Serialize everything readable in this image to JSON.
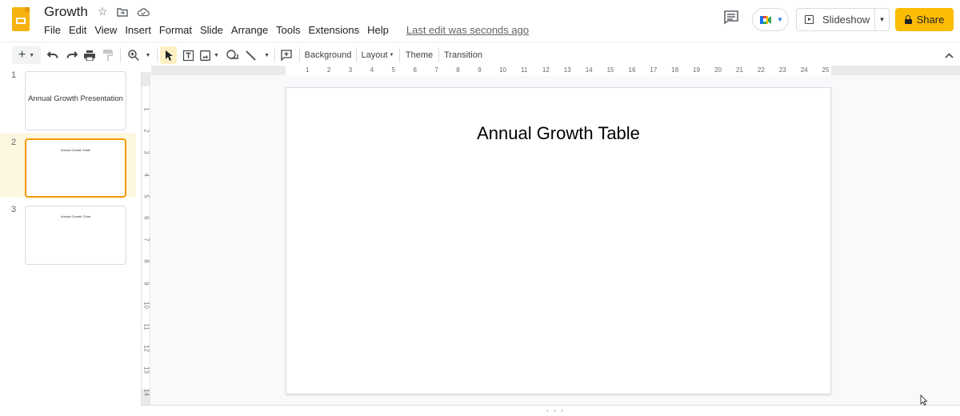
{
  "app": {
    "document_title": "Growth",
    "title_icons": [
      "star-icon",
      "move-to-folder-icon",
      "cloud-saved-icon"
    ],
    "menu": [
      "File",
      "Edit",
      "View",
      "Insert",
      "Format",
      "Slide",
      "Arrange",
      "Tools",
      "Extensions",
      "Help"
    ],
    "last_edit": "Last edit was seconds ago"
  },
  "header_actions": {
    "slideshow_label": "Slideshow",
    "share_label": "Share",
    "accent_color": "#fbbc04"
  },
  "toolbar": {
    "background_label": "Background",
    "layout_label": "Layout",
    "theme_label": "Theme",
    "transition_label": "Transition"
  },
  "filmstrip": {
    "slides": [
      {
        "number": "1",
        "title": "Annual Growth Presentation",
        "selected": false
      },
      {
        "number": "2",
        "title": "Annual Growth Table",
        "selected": true
      },
      {
        "number": "3",
        "title": "Annual Growth Chart",
        "selected": false
      }
    ]
  },
  "rulers": {
    "horizontal": [
      "1",
      "2",
      "3",
      "4",
      "5",
      "6",
      "7",
      "8",
      "9",
      "10",
      "11",
      "12",
      "13",
      "14",
      "15",
      "16",
      "17",
      "18",
      "19",
      "20",
      "21",
      "22",
      "23",
      "24",
      "25"
    ],
    "vertical": [
      "1",
      "2",
      "3",
      "4",
      "5",
      "6",
      "7",
      "8",
      "9",
      "10",
      "11",
      "12",
      "13",
      "14"
    ]
  },
  "current_slide": {
    "title": "Annual Growth Table"
  }
}
